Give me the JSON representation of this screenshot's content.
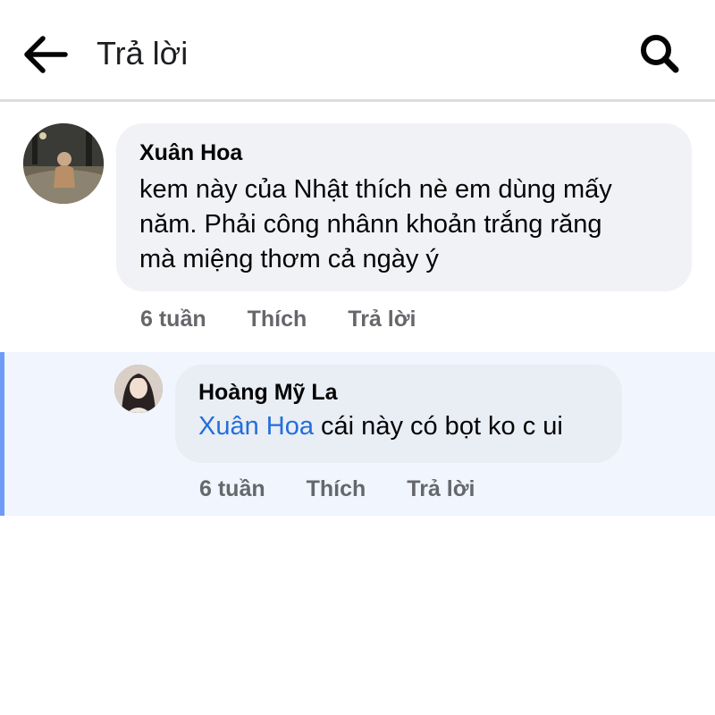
{
  "header": {
    "title": "Trả lời",
    "back_icon": "arrow-left-icon",
    "search_icon": "search-icon"
  },
  "comments": [
    {
      "author": "Xuân Hoa",
      "text_lines": [
        "kem này của Nhật thích nè em dùng mấy",
        "năm. Phải công nhânn khoản trắng răng",
        "mà miệng thơm cả ngày ý"
      ],
      "time": "6 tuần",
      "like_label": "Thích",
      "reply_label": "Trả lời"
    },
    {
      "author": "Hoàng Mỹ La",
      "mention": "Xuân Hoa",
      "text": " cái này có bọt ko c ui",
      "time": "6 tuần",
      "like_label": "Thích",
      "reply_label": "Trả lời"
    }
  ],
  "colors": {
    "mention": "#216fdb",
    "reply_highlight": "#f0f5fe",
    "reply_accent": "#6c9cf5",
    "bubble": "#f0f2f5",
    "action_text": "#65676b"
  }
}
